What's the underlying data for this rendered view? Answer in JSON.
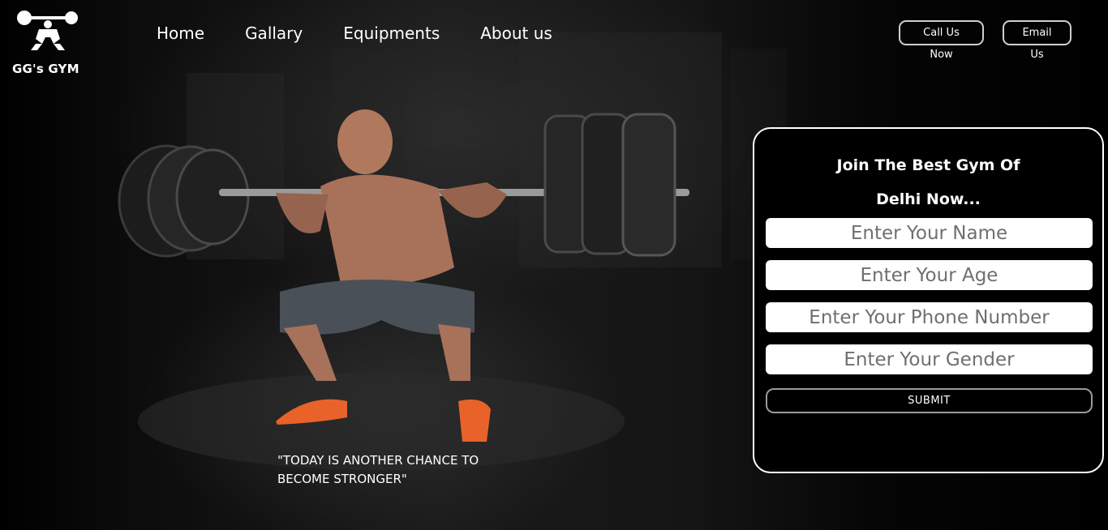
{
  "brand": {
    "name": "GG's GYM",
    "logo_icon": "weightlifter-icon"
  },
  "nav": {
    "items": [
      "Home",
      "Gallary",
      "Equipments",
      "About us"
    ]
  },
  "actions": {
    "call": "Call Us Now",
    "email": "Email Us"
  },
  "hero": {
    "quote": "\"TODAY IS ANOTHER CHANCE TO BECOME STRONGER\"",
    "image_icon": "weightlifter-squat-photo"
  },
  "form": {
    "title_line1": "Join The Best Gym Of",
    "title_line2": "Delhi Now...",
    "name_placeholder": "Enter Your Name",
    "age_placeholder": "Enter Your Age",
    "phone_placeholder": "Enter Your Phone Number",
    "gender_placeholder": "Enter Your Gender",
    "submit": "SUBMIT"
  },
  "colors": {
    "background": "#000000",
    "text": "#ffffff",
    "accent_shoes": "#e8622a"
  }
}
